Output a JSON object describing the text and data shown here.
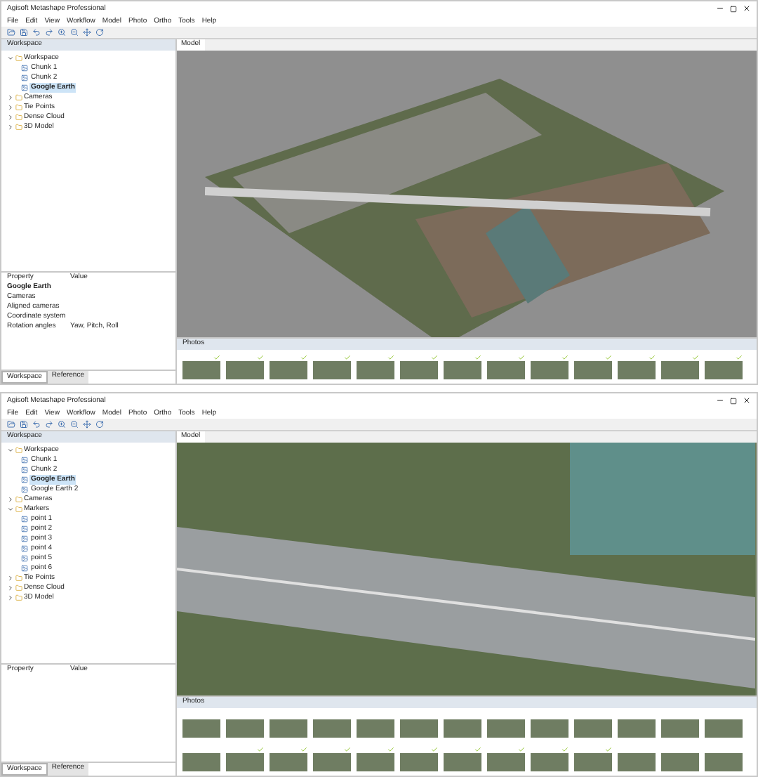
{
  "windows": [
    {
      "title": "Agisoft Metashape Professional",
      "menu": [
        "File",
        "Edit",
        "View",
        "Workflow",
        "Model",
        "Photo",
        "Ortho",
        "Tools",
        "Help"
      ],
      "workspace_title": "Workspace",
      "tree": [
        {
          "label": "Workspace",
          "expanded": true,
          "children": [
            {
              "label": "Chunk 1",
              "selected": false
            },
            {
              "label": "Chunk 2",
              "selected": false
            },
            {
              "label": "Google Earth",
              "selected": true
            }
          ]
        },
        {
          "label": "Cameras",
          "expanded": false
        },
        {
          "label": "Tie Points",
          "expanded": false
        },
        {
          "label": "Dense Cloud",
          "expanded": false
        },
        {
          "label": "3D Model",
          "expanded": false
        }
      ],
      "properties": {
        "headers": [
          "Property",
          "Value"
        ],
        "rows": [
          [
            "Google Earth",
            ""
          ],
          [
            "Cameras",
            ""
          ],
          [
            "Aligned cameras",
            ""
          ],
          [
            "Coordinate system",
            ""
          ],
          [
            "Rotation angles",
            "Yaw, Pitch, Roll"
          ]
        ]
      },
      "bottom_tabs": [
        {
          "label": "Workspace",
          "selected": true
        },
        {
          "label": "Reference",
          "selected": false
        }
      ],
      "view_tab": "Model",
      "kind": "overview",
      "photos_title": "Photos",
      "thumb_rows": [
        [
          {
            "checked": true
          },
          {
            "checked": true
          },
          {
            "checked": true
          },
          {
            "checked": true
          },
          {
            "checked": true
          },
          {
            "checked": true
          },
          {
            "checked": true
          },
          {
            "checked": true
          },
          {
            "checked": true
          },
          {
            "checked": true
          },
          {
            "checked": true
          },
          {
            "checked": true
          },
          {
            "checked": true
          }
        ]
      ]
    },
    {
      "title": "Agisoft Metashape Professional",
      "menu": [
        "File",
        "Edit",
        "View",
        "Workflow",
        "Model",
        "Photo",
        "Ortho",
        "Tools",
        "Help"
      ],
      "workspace_title": "Workspace",
      "tree": [
        {
          "label": "Workspace",
          "expanded": true,
          "children": [
            {
              "label": "Chunk 1",
              "selected": false
            },
            {
              "label": "Chunk 2",
              "selected": false
            },
            {
              "label": "Google Earth",
              "selected": true
            },
            {
              "label": "Google Earth 2",
              "selected": false
            }
          ]
        },
        {
          "label": "Cameras",
          "expanded": false
        },
        {
          "label": "Markers",
          "expanded": true,
          "children": [
            {
              "label": "point 1",
              "selected": false
            },
            {
              "label": "point 2",
              "selected": false
            },
            {
              "label": "point 3",
              "selected": false
            },
            {
              "label": "point 4",
              "selected": false
            },
            {
              "label": "point 5",
              "selected": false
            },
            {
              "label": "point 6",
              "selected": false
            }
          ]
        },
        {
          "label": "Tie Points",
          "expanded": false
        },
        {
          "label": "Dense Cloud",
          "expanded": false
        },
        {
          "label": "3D Model",
          "expanded": false
        }
      ],
      "properties": {
        "headers": [
          "Property",
          "Value"
        ]
      },
      "bottom_tabs": [
        {
          "label": "Workspace",
          "selected": true
        },
        {
          "label": "Reference",
          "selected": false
        }
      ],
      "view_tab": "Model",
      "kind": "closeup",
      "photos_title": "Photos",
      "thumb_rows": [
        [
          {
            "checked": false
          },
          {
            "checked": false
          },
          {
            "checked": false
          },
          {
            "checked": false
          },
          {
            "checked": false
          },
          {
            "checked": false
          },
          {
            "checked": false
          },
          {
            "checked": false
          },
          {
            "checked": false
          },
          {
            "checked": false
          },
          {
            "checked": false
          },
          {
            "checked": false
          },
          {
            "checked": false
          }
        ],
        [
          {
            "checked": false
          },
          {
            "checked": true
          },
          {
            "checked": true
          },
          {
            "checked": true
          },
          {
            "checked": true
          },
          {
            "checked": true
          },
          {
            "checked": true
          },
          {
            "checked": true
          },
          {
            "checked": true
          },
          {
            "checked": true
          },
          {
            "checked": false
          },
          {
            "checked": false
          },
          {
            "checked": false
          }
        ]
      ]
    }
  ]
}
